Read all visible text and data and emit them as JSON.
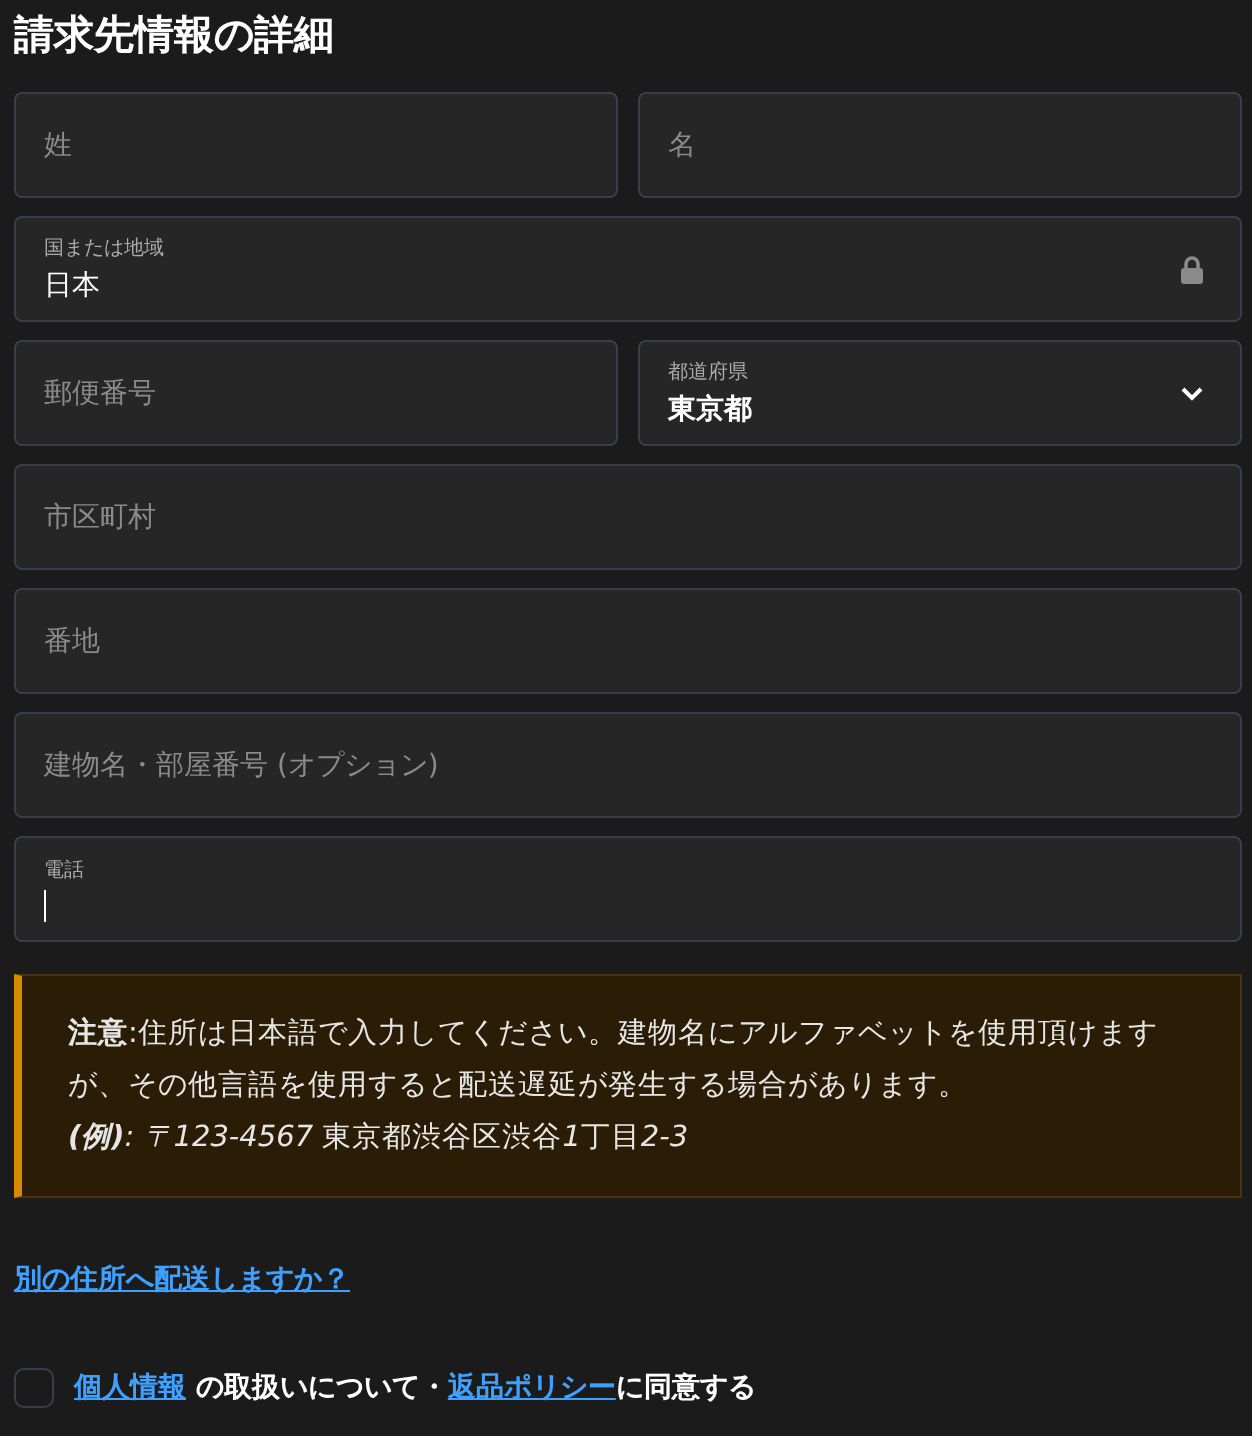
{
  "title": "請求先情報の詳細",
  "rows": [
    {
      "fields": [
        {
          "kind": "empty",
          "placeholder": "姓"
        },
        {
          "kind": "empty",
          "placeholder": "名"
        }
      ]
    },
    {
      "fields": [
        {
          "kind": "locked",
          "label": "国または地域",
          "value": "日本"
        }
      ]
    },
    {
      "fields": [
        {
          "kind": "empty",
          "placeholder": "郵便番号"
        },
        {
          "kind": "select",
          "label": "都道府県",
          "value": "東京都"
        }
      ]
    },
    {
      "fields": [
        {
          "kind": "empty",
          "placeholder": "市区町村"
        }
      ]
    },
    {
      "fields": [
        {
          "kind": "empty",
          "placeholder": "番地"
        }
      ]
    },
    {
      "fields": [
        {
          "kind": "empty",
          "placeholder": "建物名・部屋番号 (オプション)"
        }
      ]
    },
    {
      "fields": [
        {
          "kind": "focused",
          "label": "電話"
        }
      ]
    }
  ],
  "note": {
    "text": "**注意**:住所は日本語で入力してください。建物名にアルファベットを使用頂けますが、その他言語を使用すると配送遅延が発生する場合があります。",
    "example": [
      {
        "kind": "label",
        "text": "(例)"
      },
      {
        "kind": "italic",
        "text": ": 〒123-4567 "
      },
      {
        "kind": "plain",
        "text": "東京都渋谷区渋谷"
      },
      {
        "kind": "italic",
        "text": "1"
      },
      {
        "kind": "plain",
        "text": "丁目"
      },
      {
        "kind": "italic",
        "text": "2-3"
      }
    ]
  },
  "ship_link": "別の住所へ配送しますか？",
  "agreement": {
    "checked": false,
    "parts": [
      {
        "kind": "link",
        "text": "個人情報"
      },
      {
        "kind": "text",
        "text": " の取扱いについて・"
      },
      {
        "kind": "link",
        "text": "返品ポリシー"
      },
      {
        "kind": "text",
        "text": "に同意する"
      }
    ]
  }
}
